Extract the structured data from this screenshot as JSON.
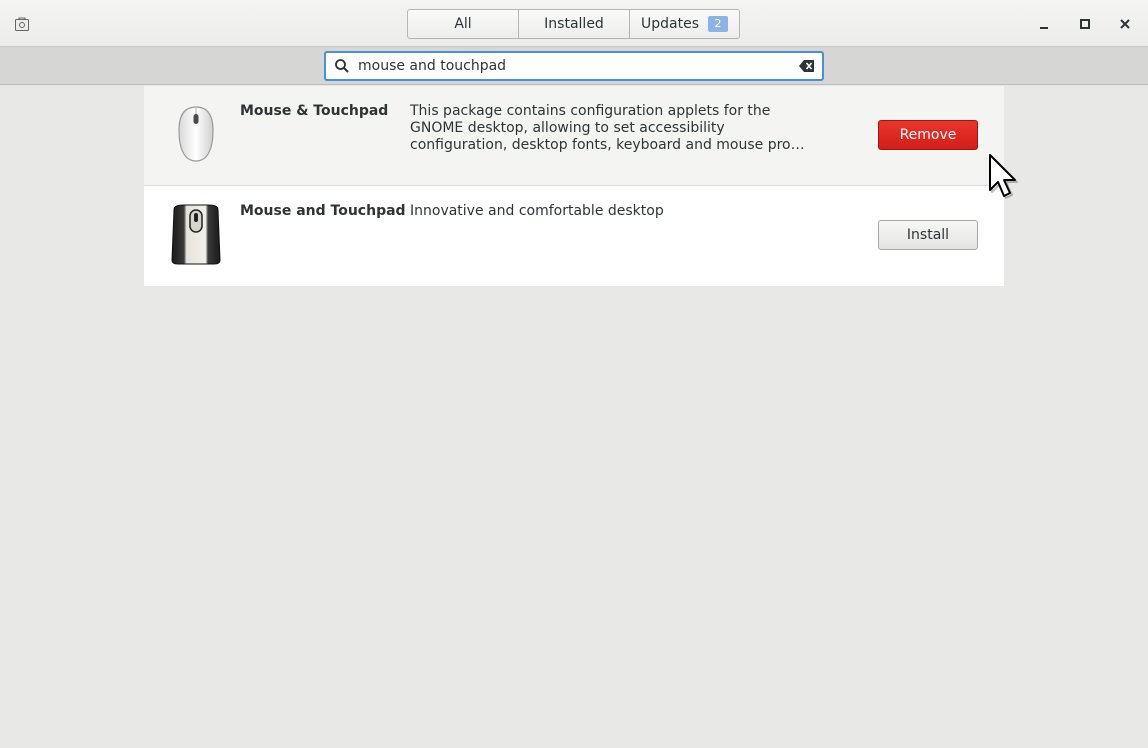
{
  "header": {
    "tabs": [
      {
        "label": "All"
      },
      {
        "label": "Installed"
      },
      {
        "label": "Updates",
        "badge": "2"
      }
    ]
  },
  "search": {
    "value": "mouse and touchpad"
  },
  "results": [
    {
      "name": "Mouse & Touchpad",
      "description_lines": [
        "This package contains configuration applets for the",
        "GNOME desktop, allowing to set accessibility",
        "configuration, desktop fonts, keyboard and mouse pro…"
      ],
      "action": "Remove",
      "icon": "mouse-white-icon"
    },
    {
      "name": "Mouse and Touchpad",
      "description_lines": [
        "Innovative and comfortable desktop"
      ],
      "action": "Install",
      "icon": "mouse-black-icon"
    }
  ],
  "colors": {
    "accent": "#4a90d9",
    "remove": "#e02a23",
    "badge": "#8cb2e6"
  }
}
